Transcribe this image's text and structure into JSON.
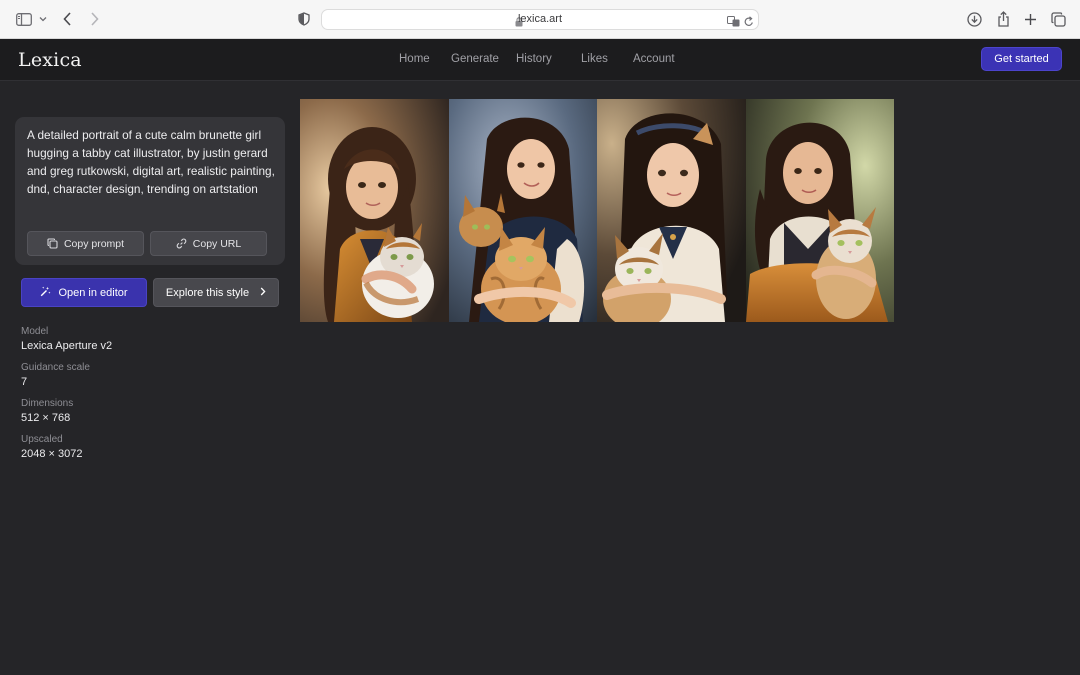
{
  "browser": {
    "url": "lexica.art"
  },
  "site": {
    "logo": "Lexica",
    "nav": [
      {
        "label": "Home"
      },
      {
        "label": "Generate"
      },
      {
        "label": "History"
      },
      {
        "label": "Likes"
      },
      {
        "label": "Account"
      }
    ],
    "cta_label": "Get started"
  },
  "prompt": {
    "text": "A detailed portrait of a cute calm brunette girl hugging a tabby cat illustrator, by justin gerard and greg rutkowski, digital art, realistic painting, dnd, character design, trending on artstation",
    "copy_prompt_label": "Copy prompt",
    "copy_url_label": "Copy URL"
  },
  "actions": {
    "open_editor_label": "Open in editor",
    "explore_label": "Explore this style"
  },
  "metadata": [
    {
      "label": "Model",
      "value": "Lexica Aperture v2"
    },
    {
      "label": "Guidance scale",
      "value": "7"
    },
    {
      "label": "Dimensions",
      "value": "512 × 768"
    },
    {
      "label": "Upscaled",
      "value": "2048 × 3072"
    }
  ],
  "images": [
    {
      "name": "generated-image-1"
    },
    {
      "name": "generated-image-2"
    },
    {
      "name": "generated-image-3"
    },
    {
      "name": "generated-image-4"
    }
  ],
  "colors": {
    "page_bg": "#252528",
    "header_bg": "#1c1c1e",
    "accent": "#3b33b5",
    "card_bg": "#353539"
  }
}
